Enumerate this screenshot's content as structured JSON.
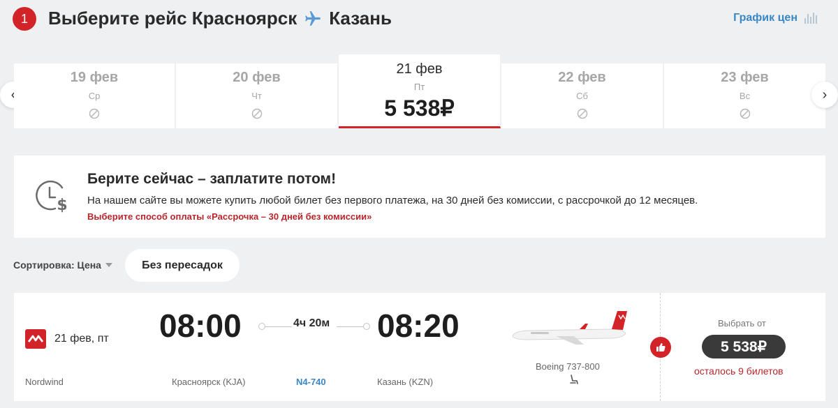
{
  "header": {
    "step_number": "1",
    "title_prefix": "Выберите рейс Красноярск",
    "destination": "Казань",
    "price_chart_label": "График цен"
  },
  "dates": [
    {
      "date": "19 фев",
      "weekday": "Ср",
      "available": false
    },
    {
      "date": "20 фев",
      "weekday": "Чт",
      "available": false
    },
    {
      "date": "21 фев",
      "weekday": "Пт",
      "price": "5 538₽",
      "selected": true
    },
    {
      "date": "22 фев",
      "weekday": "Сб",
      "available": false
    },
    {
      "date": "23 фев",
      "weekday": "Вс",
      "available": false
    }
  ],
  "promo": {
    "title": "Берите сейчас – заплатите потом!",
    "text": "На нашем сайте вы можете купить любой билет без первого платежа, на 30 дней без комиссии, с рассрочкой до 12 месяцев.",
    "link": "Выберите способ оплаты «Рассрочка – 30 дней без комиссии»"
  },
  "sort": {
    "label": "Сортировка: Цена",
    "filter_chip": "Без пересадок"
  },
  "flight": {
    "date": "21 фев, пт",
    "departure_time": "08:00",
    "arrival_time": "08:20",
    "duration": "4ч 20м",
    "airline": "Nordwind",
    "departure_airport": "Красноярск (KJA)",
    "flight_number": "N4-740",
    "arrival_airport": "Казань (KZN)",
    "aircraft": "Boeing 737-800",
    "select_label": "Выбрать от",
    "price": "5 538₽",
    "seats_left": "осталось 9 билетов"
  },
  "colors": {
    "accent": "#d22328",
    "link": "#3a87c5",
    "background": "#eef0f2"
  }
}
